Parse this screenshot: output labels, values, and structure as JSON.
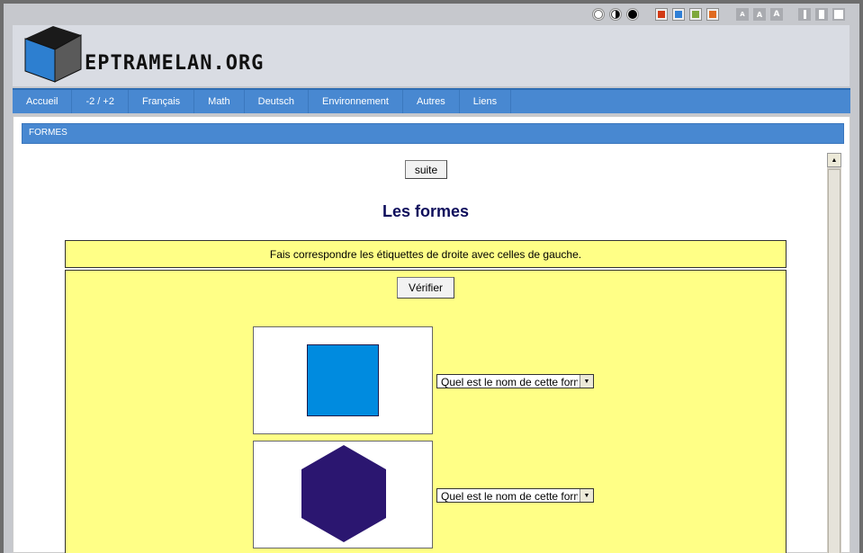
{
  "site": {
    "name": "EPTRAMELAN.ORG"
  },
  "toolbar": {
    "contrast": [
      "white",
      "half",
      "black"
    ],
    "colors": [
      "#d23a14",
      "#2f7fd6",
      "#7ea83a",
      "#e06a1f"
    ],
    "font_sizes": [
      "A",
      "A",
      "A"
    ],
    "widths": [
      "narrow",
      "medium",
      "wide"
    ]
  },
  "nav": {
    "items": [
      "Accueil",
      "-2 / +2",
      "Français",
      "Math",
      "Deutsch",
      "Environnement",
      "Autres",
      "Liens"
    ]
  },
  "section": {
    "title": "FORMES"
  },
  "page": {
    "next_label": "suite",
    "title": "Les formes",
    "instructions": "Fais correspondre les étiquettes de droite avec celles de gauche.",
    "verify_label": "Vérifier"
  },
  "exercise": {
    "questions": [
      {
        "shape": "square",
        "color": "#008bdf",
        "select_value": "Quel est le nom de cette forme ?"
      },
      {
        "shape": "hexagon",
        "color": "#2b1670",
        "select_value": "Quel est le nom de cette forme ?"
      }
    ]
  },
  "icons": {
    "dropdown_arrow": "▼",
    "scroll_up": "▲"
  }
}
